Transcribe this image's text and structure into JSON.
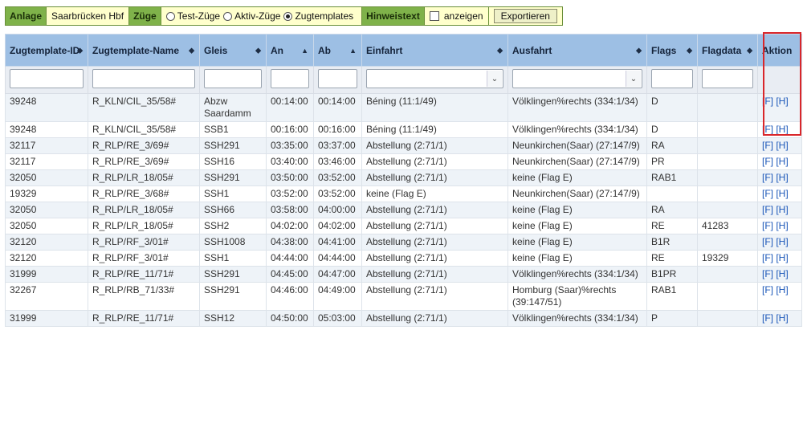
{
  "toolbar": {
    "anlage_label": "Anlage",
    "anlage_value": "Saarbrücken Hbf",
    "zuege_label": "Züge",
    "radios": [
      {
        "label": "Test-Züge",
        "checked": false
      },
      {
        "label": "Aktiv-Züge",
        "checked": false
      },
      {
        "label": "Zugtemplates",
        "checked": true
      }
    ],
    "hinweis_label": "Hinweistext",
    "hinweis_checkbox_label": "anzeigen",
    "export_label": "Exportieren"
  },
  "table": {
    "headers": [
      {
        "label": "Zugtemplate-ID",
        "sort": "◆"
      },
      {
        "label": "Zugtemplate-Name",
        "sort": "◆"
      },
      {
        "label": "Gleis",
        "sort": "◆"
      },
      {
        "label": "An",
        "sort": "▲"
      },
      {
        "label": "Ab",
        "sort": "▲"
      },
      {
        "label": "Einfahrt",
        "sort": "◆"
      },
      {
        "label": "Ausfahrt",
        "sort": "◆"
      },
      {
        "label": "Flags",
        "sort": "◆"
      },
      {
        "label": "Flagdata",
        "sort": "◆"
      },
      {
        "label": "Aktion",
        "sort": ""
      }
    ],
    "rows": [
      [
        "39248",
        "R_KLN/CIL_35/58#",
        "Abzw Saardamm",
        "00:14:00",
        "00:14:00",
        "Béning (11:1/49)",
        "Völklingen%rechts (334:1/34)",
        "D",
        ""
      ],
      [
        "39248",
        "R_KLN/CIL_35/58#",
        "SSB1",
        "00:16:00",
        "00:16:00",
        "Béning (11:1/49)",
        "Völklingen%rechts (334:1/34)",
        "D",
        ""
      ],
      [
        "32117",
        "R_RLP/RE_3/69#",
        "SSH291",
        "03:35:00",
        "03:37:00",
        "Abstellung (2:71/1)",
        "Neunkirchen(Saar) (27:147/9)",
        "RA",
        ""
      ],
      [
        "32117",
        "R_RLP/RE_3/69#",
        "SSH16",
        "03:40:00",
        "03:46:00",
        "Abstellung (2:71/1)",
        "Neunkirchen(Saar) (27:147/9)",
        "PR",
        ""
      ],
      [
        "32050",
        "R_RLP/LR_18/05#",
        "SSH291",
        "03:50:00",
        "03:52:00",
        "Abstellung (2:71/1)",
        "keine (Flag E)",
        "RAB1",
        ""
      ],
      [
        "19329",
        "R_RLP/RE_3/68#",
        "SSH1",
        "03:52:00",
        "03:52:00",
        "keine (Flag E)",
        "Neunkirchen(Saar) (27:147/9)",
        "",
        ""
      ],
      [
        "32050",
        "R_RLP/LR_18/05#",
        "SSH66",
        "03:58:00",
        "04:00:00",
        "Abstellung (2:71/1)",
        "keine (Flag E)",
        "RA",
        ""
      ],
      [
        "32050",
        "R_RLP/LR_18/05#",
        "SSH2",
        "04:02:00",
        "04:02:00",
        "Abstellung (2:71/1)",
        "keine (Flag E)",
        "RE",
        "41283"
      ],
      [
        "32120",
        "R_RLP/RF_3/01#",
        "SSH1008",
        "04:38:00",
        "04:41:00",
        "Abstellung (2:71/1)",
        "keine (Flag E)",
        "B1R",
        ""
      ],
      [
        "32120",
        "R_RLP/RF_3/01#",
        "SSH1",
        "04:44:00",
        "04:44:00",
        "Abstellung (2:71/1)",
        "keine (Flag E)",
        "RE",
        "19329"
      ],
      [
        "31999",
        "R_RLP/RE_11/71#",
        "SSH291",
        "04:45:00",
        "04:47:00",
        "Abstellung (2:71/1)",
        "Völklingen%rechts (334:1/34)",
        "B1PR",
        ""
      ],
      [
        "32267",
        "R_RLP/RB_71/33#",
        "SSH291",
        "04:46:00",
        "04:49:00",
        "Abstellung (2:71/1)",
        "Homburg (Saar)%rechts (39:147/51)",
        "RAB1",
        ""
      ],
      [
        "31999",
        "R_RLP/RE_11/71#",
        "SSH12",
        "04:50:00",
        "05:03:00",
        "Abstellung (2:71/1)",
        "Völklingen%rechts (334:1/34)",
        "P",
        ""
      ]
    ],
    "action_f": "[F]",
    "action_h": "[H]"
  }
}
